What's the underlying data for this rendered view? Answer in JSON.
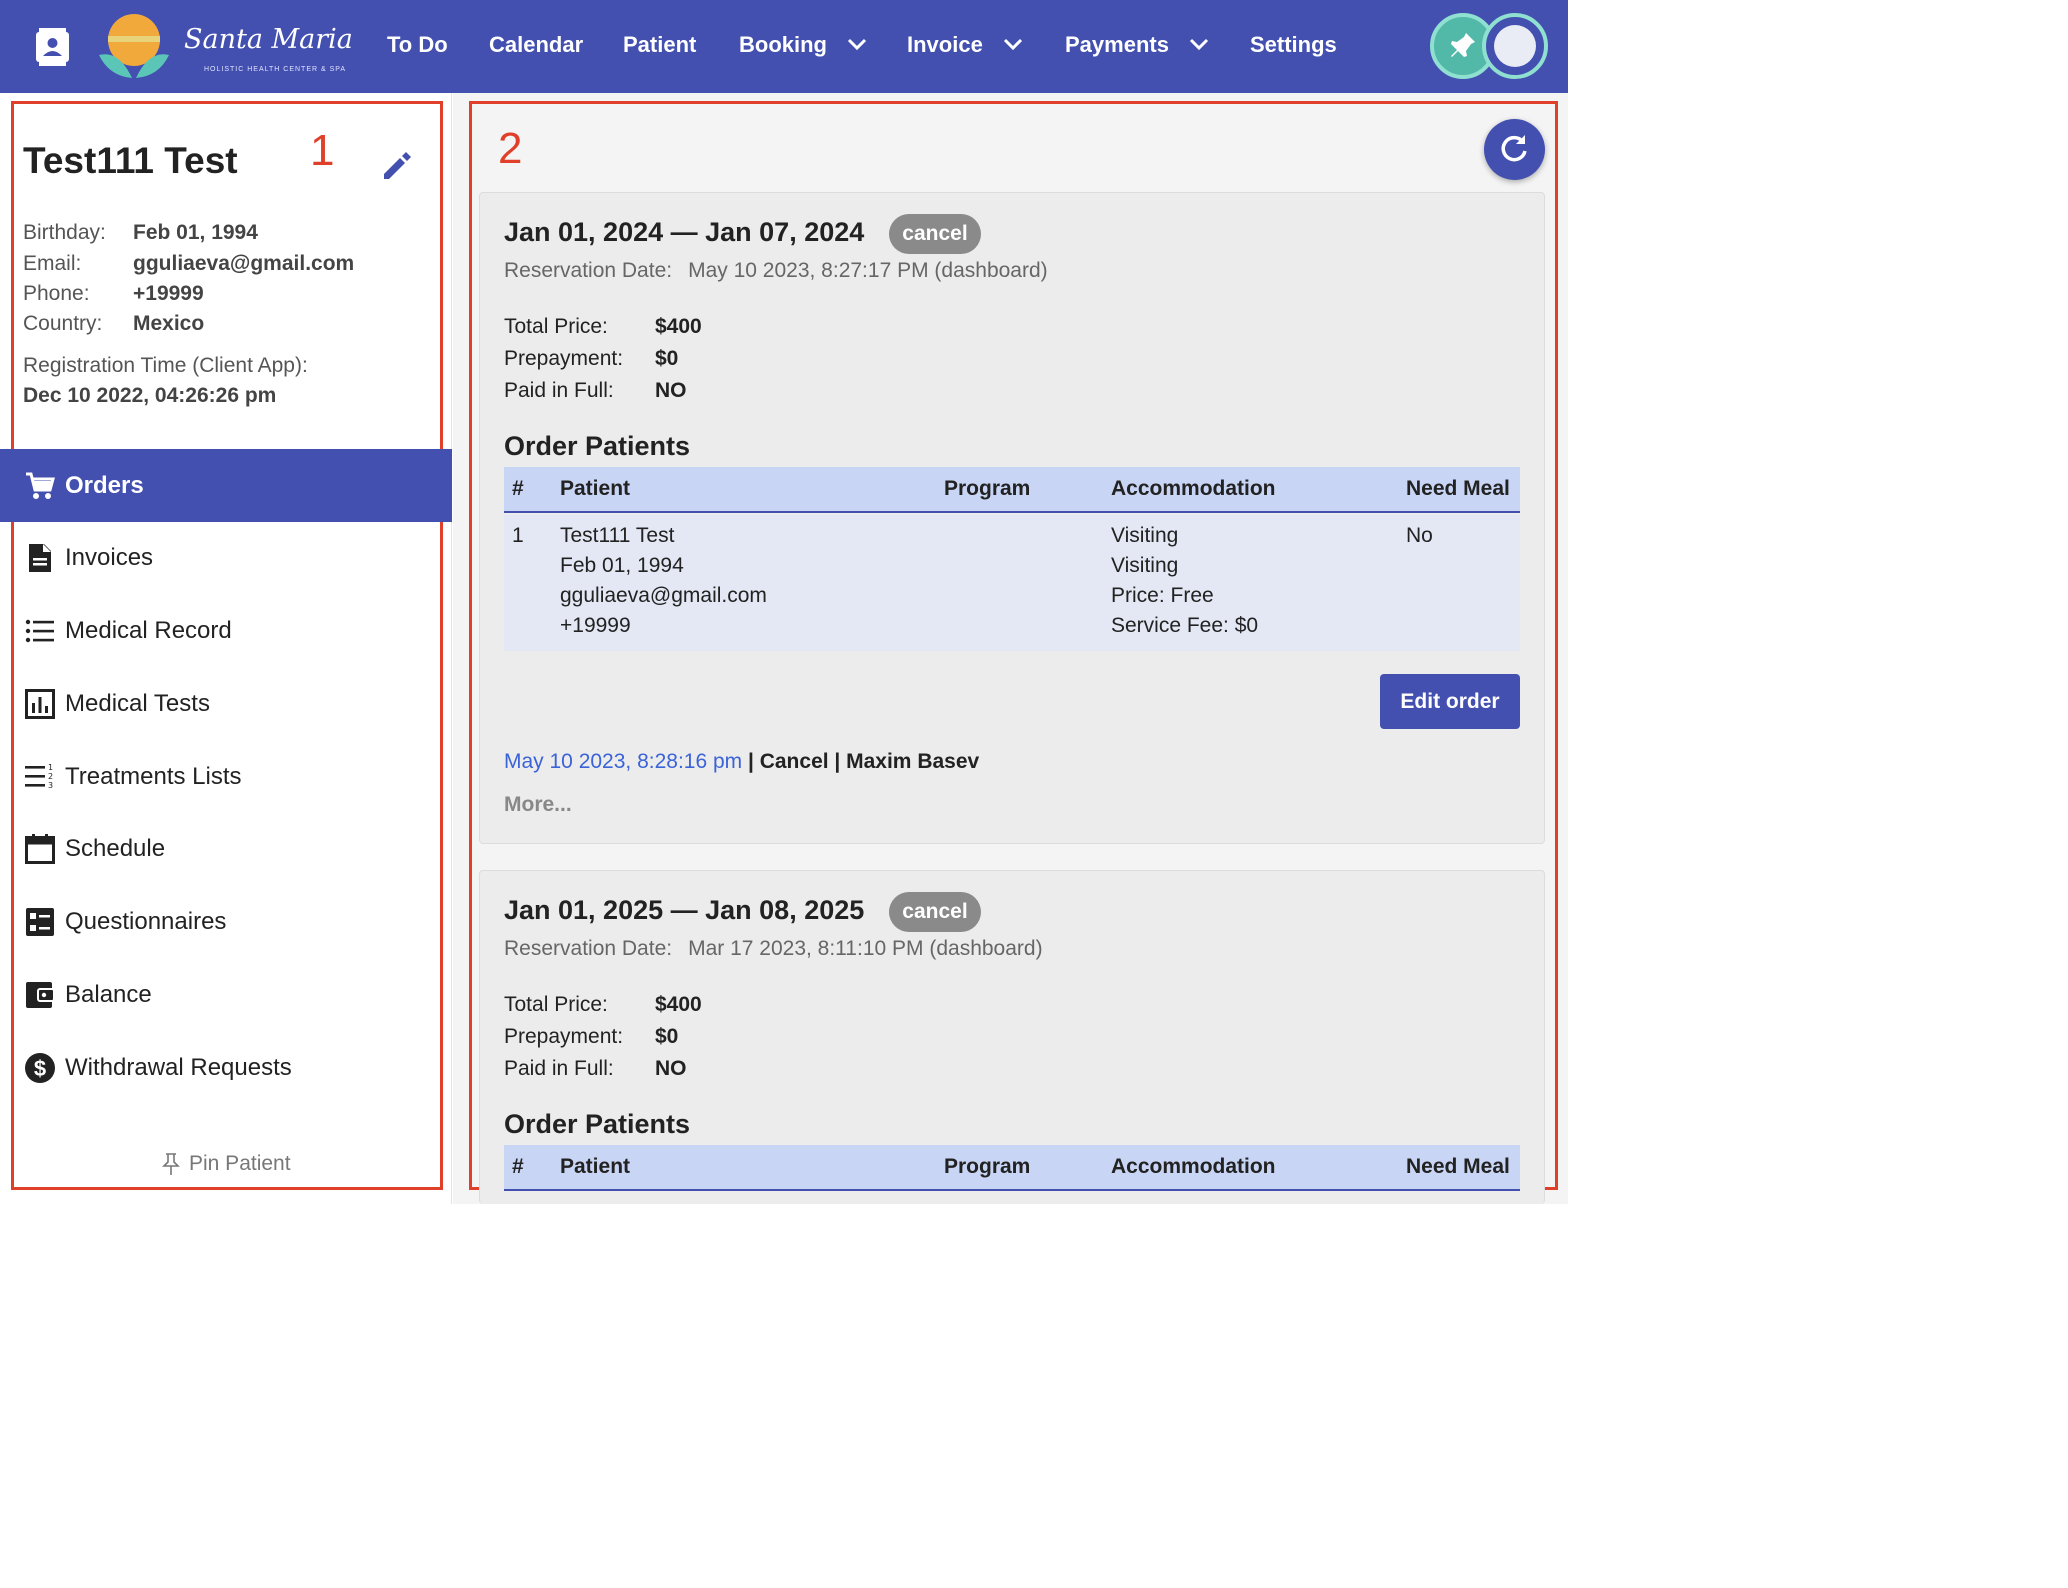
{
  "header": {
    "logo_text": "Santa Maria",
    "logo_subtitle": "HOLISTIC HEALTH CENTER & SPA",
    "nav": [
      {
        "label": "To Do"
      },
      {
        "label": "Calendar"
      },
      {
        "label": "Patient"
      },
      {
        "label": "Booking"
      },
      {
        "label": "Invoice"
      },
      {
        "label": "Payments"
      },
      {
        "label": "Settings"
      }
    ],
    "icons": [
      "contacts-icon",
      "pin-icon",
      "avatar"
    ],
    "accent_color": "#4350b0"
  },
  "annotations": {
    "left": "1",
    "right": "2"
  },
  "patient": {
    "name": "Test111 Test",
    "fields": [
      {
        "label": "Birthday:",
        "value": "Feb 01, 1994"
      },
      {
        "label": "Email:",
        "value": "gguliaeva@gmail.com"
      },
      {
        "label": "Phone:",
        "value": "+19999"
      },
      {
        "label": "Country:",
        "value": "Mexico"
      }
    ],
    "registration_label": "Registration Time (Client App):",
    "registration_value": "Dec 10 2022, 04:26:26 pm"
  },
  "sidebar": {
    "items": [
      {
        "label": "Orders",
        "icon": "cart-icon",
        "active": true
      },
      {
        "label": "Invoices",
        "icon": "document-icon"
      },
      {
        "label": "Medical Record",
        "icon": "list-icon"
      },
      {
        "label": "Medical Tests",
        "icon": "chart-icon"
      },
      {
        "label": "Treatments Lists",
        "icon": "numbered-list-icon"
      },
      {
        "label": "Schedule",
        "icon": "calendar-icon"
      },
      {
        "label": "Questionnaires",
        "icon": "checklist-icon"
      },
      {
        "label": "Balance",
        "icon": "wallet-icon"
      },
      {
        "label": "Withdrawal Requests",
        "icon": "dollar-icon"
      }
    ],
    "pin_label": "Pin Patient"
  },
  "orders": [
    {
      "dates": "Jan 01, 2024 — Jan 07, 2024",
      "status": "cancel",
      "reservation_label": "Reservation Date:",
      "reservation_value": "May 10 2023, 8:27:17 PM (dashboard)",
      "total_price_label": "Total Price:",
      "total_price": "$400",
      "prepayment_label": "Prepayment:",
      "prepayment": "$0",
      "paid_label": "Paid in Full:",
      "paid": "NO",
      "patients_title": "Order Patients",
      "columns": [
        "#",
        "Patient",
        "Program",
        "Accommodation",
        "Need Meal"
      ],
      "rows": [
        {
          "num": "1",
          "patient": [
            "Test111 Test",
            "Feb 01, 1994",
            "gguliaeva@gmail.com",
            "+19999"
          ],
          "program": "",
          "accommodation": [
            "Visiting",
            "Visiting",
            "Price: Free",
            "Service Fee: $0"
          ],
          "need_meal": "No"
        }
      ],
      "edit_label": "Edit order",
      "log_time": "May 10 2023, 8:28:16 pm",
      "log_action": " | Cancel | Maxim Basev",
      "more_label": "More..."
    },
    {
      "dates": "Jan 01, 2025 — Jan 08, 2025",
      "status": "cancel",
      "reservation_label": "Reservation Date:",
      "reservation_value": "Mar 17 2023, 8:11:10 PM (dashboard)",
      "total_price_label": "Total Price:",
      "total_price": "$400",
      "prepayment_label": "Prepayment:",
      "prepayment": "$0",
      "paid_label": "Paid in Full:",
      "paid": "NO",
      "patients_title": "Order Patients",
      "columns": [
        "#",
        "Patient",
        "Program",
        "Accommodation",
        "Need Meal"
      ]
    }
  ]
}
